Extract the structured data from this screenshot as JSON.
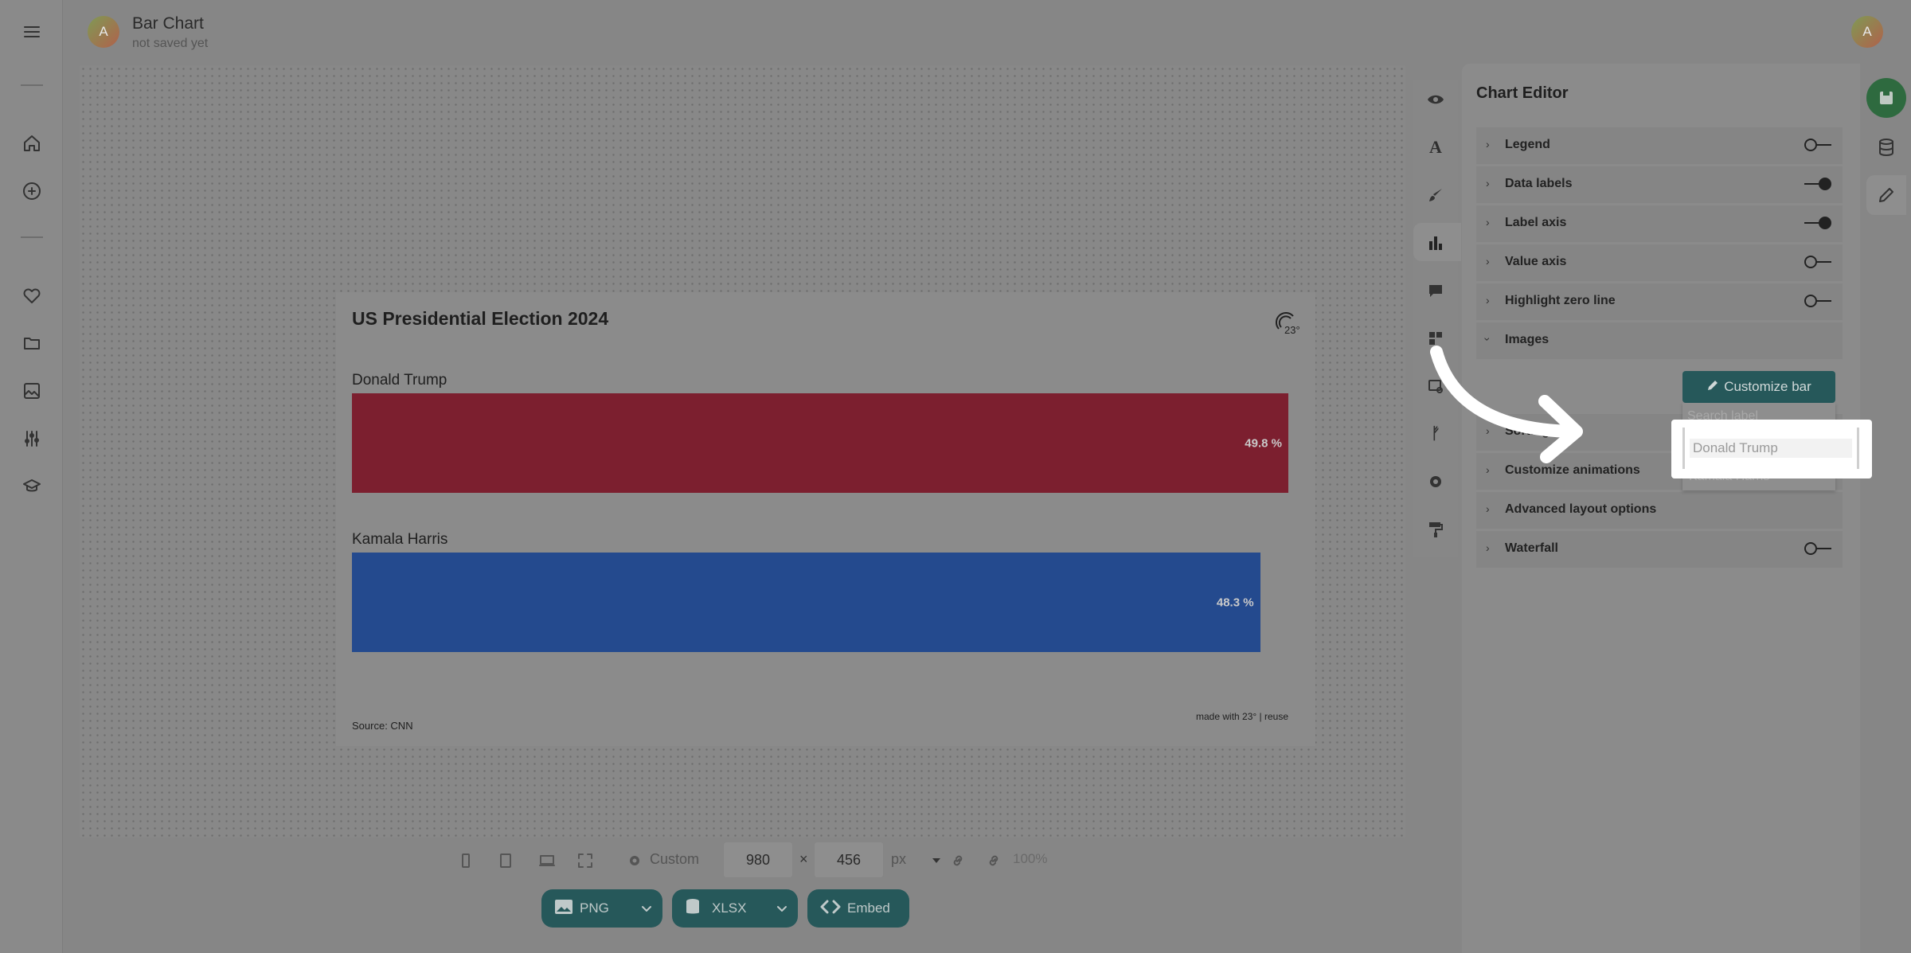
{
  "header": {
    "avatar_initial": "A",
    "title": "Bar Chart",
    "subtitle": "not saved yet",
    "user_avatar_initial": "A"
  },
  "left_rail": {
    "icons": [
      "menu-icon",
      "home-icon",
      "add-icon",
      "heart-icon",
      "folder-icon",
      "image-icon",
      "sliders-icon",
      "graduation-cap-icon"
    ]
  },
  "chart": {
    "title": "US Presidential Election 2024",
    "logo_text": "23°",
    "source": "Source: CNN",
    "made_with": "made with 23° | reuse"
  },
  "chart_data": {
    "type": "bar",
    "orientation": "horizontal",
    "title": "US Presidential Election 2024",
    "categories": [
      "Donald Trump",
      "Kamala Harris"
    ],
    "values": [
      49.8,
      48.3
    ],
    "value_labels": [
      "49.8 %",
      "48.3 %"
    ],
    "colors": [
      "#7c1f2f",
      "#244a8e"
    ],
    "xlim": [
      0,
      49.8
    ],
    "value_axis": false,
    "legend": false,
    "data_labels": true,
    "source": "Source: CNN"
  },
  "toolbar": {
    "size_preset": "Custom",
    "width": "980",
    "height": "456",
    "times": "×",
    "unit": "px",
    "zoom": "100%"
  },
  "export": {
    "png_label": "PNG",
    "xlsx_label": "XLSX",
    "embed_label": "Embed"
  },
  "editor": {
    "title": "Chart Editor",
    "sections": [
      {
        "label": "Legend",
        "toggle": "off"
      },
      {
        "label": "Data labels",
        "toggle": "on"
      },
      {
        "label": "Label axis",
        "toggle": "on"
      },
      {
        "label": "Value axis",
        "toggle": "off"
      },
      {
        "label": "Highlight zero line",
        "toggle": "off"
      },
      {
        "label": "Images",
        "expanded": true
      },
      {
        "label": "Sorting"
      },
      {
        "label": "Customize animations"
      },
      {
        "label": "Advanced layout options"
      },
      {
        "label": "Waterfall",
        "toggle": "off"
      }
    ],
    "customize_bar_label": "Customize bar",
    "dropdown": {
      "search_placeholder": "Search label",
      "options": [
        "Donald Trump",
        "Kamala Harris"
      ],
      "highlighted": "Donald Trump"
    }
  },
  "accent_color": "#26585a"
}
